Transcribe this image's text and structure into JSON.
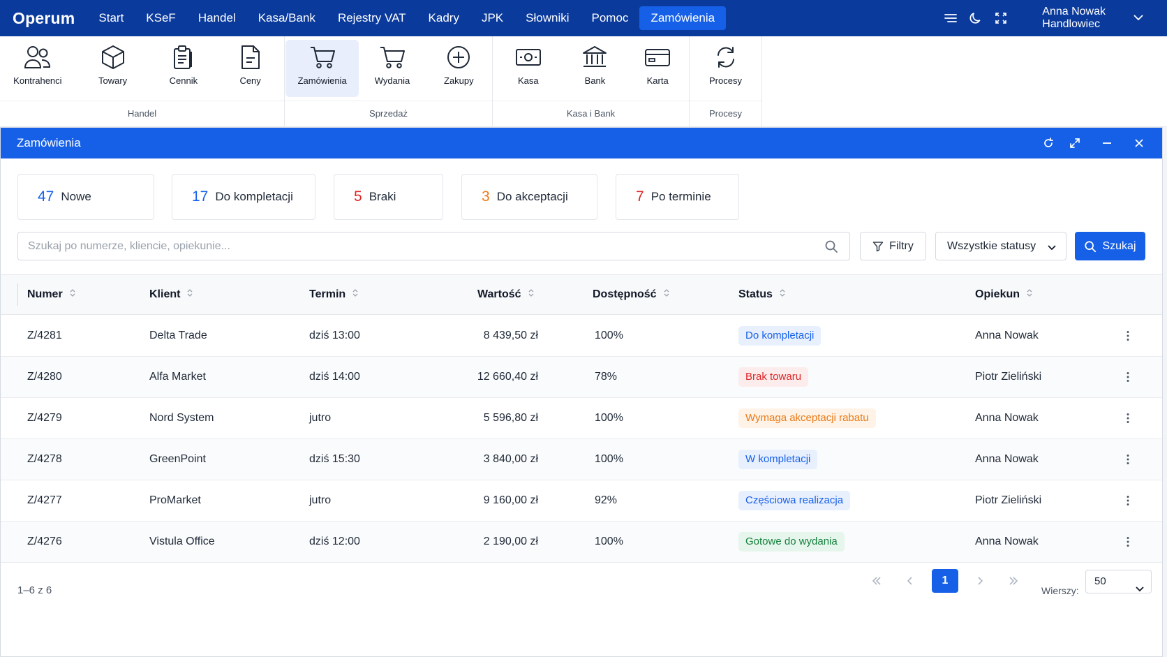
{
  "app": {
    "brand": "Operum",
    "menu": [
      "Start",
      "KSeF",
      "Handel",
      "Kasa/Bank",
      "Rejestry VAT",
      "Kadry",
      "JPK",
      "Słowniki",
      "Pomoc",
      "Zamówienia"
    ],
    "active_menu": "Zamówienia",
    "user": {
      "name": "Anna Nowak",
      "role": "Handlowiec"
    },
    "nav_icons": [
      "menu-lines-icon",
      "moon-icon",
      "fullscreen-icon"
    ]
  },
  "ribbon": {
    "groups": [
      {
        "label": "Handel",
        "items": [
          {
            "label": "Kontrahenci",
            "icon": "users-icon"
          },
          {
            "label": "Towary",
            "icon": "box-icon"
          },
          {
            "label": "Cennik",
            "icon": "clipboard-icon"
          },
          {
            "label": "Ceny",
            "icon": "document-icon"
          }
        ]
      },
      {
        "label": "Sprzedaż",
        "items": [
          {
            "label": "Zamówienia",
            "icon": "cart-icon"
          },
          {
            "label": "Wydania",
            "icon": "cart-icon"
          },
          {
            "label": "Zakupy",
            "icon": "plus-circle-icon"
          }
        ]
      },
      {
        "label": "Kasa i Bank",
        "items": [
          {
            "label": "Kasa",
            "icon": "banknote-icon"
          },
          {
            "label": "Bank",
            "icon": "bank-icon"
          },
          {
            "label": "Karta",
            "icon": "credit-card-icon"
          }
        ]
      },
      {
        "label": "Procesy",
        "items": [
          {
            "label": "Procesy",
            "icon": "sync-icon"
          }
        ]
      }
    ],
    "active_item": "Zamówienia"
  },
  "window": {
    "title": "Zamówienia",
    "controls": [
      "refresh-icon",
      "expand-icon",
      "minimize-icon",
      "close-icon"
    ]
  },
  "tiles": [
    {
      "count": "47",
      "label": "Nowe",
      "color": "#1660e8"
    },
    {
      "count": "17",
      "label": "Do kompletacji",
      "color": "#1660e8"
    },
    {
      "count": "5",
      "label": "Braki",
      "color": "#dc2626"
    },
    {
      "count": "3",
      "label": "Do akceptacji",
      "color": "#ea7a1a"
    },
    {
      "count": "7",
      "label": "Po terminie",
      "color": "#dc2626"
    }
  ],
  "search": {
    "placeholder": "Szukaj po numerze, kliencie, opiekunie...",
    "value": "",
    "filters_label": "Filtry",
    "status_select": "Wszystkie statusy",
    "search_label": "Szukaj"
  },
  "table": {
    "columns": [
      "Numer",
      "Klient",
      "Termin",
      "Wartość",
      "Dostępność",
      "Status",
      "Opiekun"
    ],
    "rows": [
      {
        "numer": "Z/4281",
        "klient": "Delta Trade",
        "termin": "dziś 13:00",
        "wartosc": "8 439,50 zł",
        "dostepnosc": "100%",
        "status": "Do kompletacji",
        "status_color": "#1660e8",
        "status_bg": "#e8f0fe",
        "opiekun": "Anna Nowak"
      },
      {
        "numer": "Z/4280",
        "klient": "Alfa Market",
        "termin": "dziś 14:00",
        "wartosc": "12 660,40 zł",
        "dostepnosc": "78%",
        "status": "Brak towaru",
        "status_color": "#dc2626",
        "status_bg": "#fdecec",
        "opiekun": "Piotr Zieliński"
      },
      {
        "numer": "Z/4279",
        "klient": "Nord System",
        "termin": "jutro",
        "wartosc": "5 596,80 zł",
        "dostepnosc": "100%",
        "status": "Wymaga akceptacji rabatu",
        "status_color": "#ea7a1a",
        "status_bg": "#fef3e6",
        "opiekun": "Anna Nowak"
      },
      {
        "numer": "Z/4278",
        "klient": "GreenPoint",
        "termin": "dziś 15:30",
        "wartosc": "3 840,00 zł",
        "dostepnosc": "100%",
        "status": "W kompletacji",
        "status_color": "#1660e8",
        "status_bg": "#e8f0fe",
        "opiekun": "Anna Nowak"
      },
      {
        "numer": "Z/4277",
        "klient": "ProMarket",
        "termin": "jutro",
        "wartosc": "9 160,00 zł",
        "dostepnosc": "92%",
        "status": "Częściowa realizacja",
        "status_color": "#1660e8",
        "status_bg": "#e8f0fe",
        "opiekun": "Piotr Zieliński"
      },
      {
        "numer": "Z/4276",
        "klient": "Vistula Office",
        "termin": "dziś 12:00",
        "wartosc": "2 190,00 zł",
        "dostepnosc": "100%",
        "status": "Gotowe do wydania",
        "status_color": "#15803d",
        "status_bg": "#e7f6ec",
        "opiekun": "Anna Nowak"
      }
    ]
  },
  "footer": {
    "count": "1–6 z 6",
    "current_page": "1",
    "rows_label": "Wierszy:",
    "rows_value": "50"
  }
}
